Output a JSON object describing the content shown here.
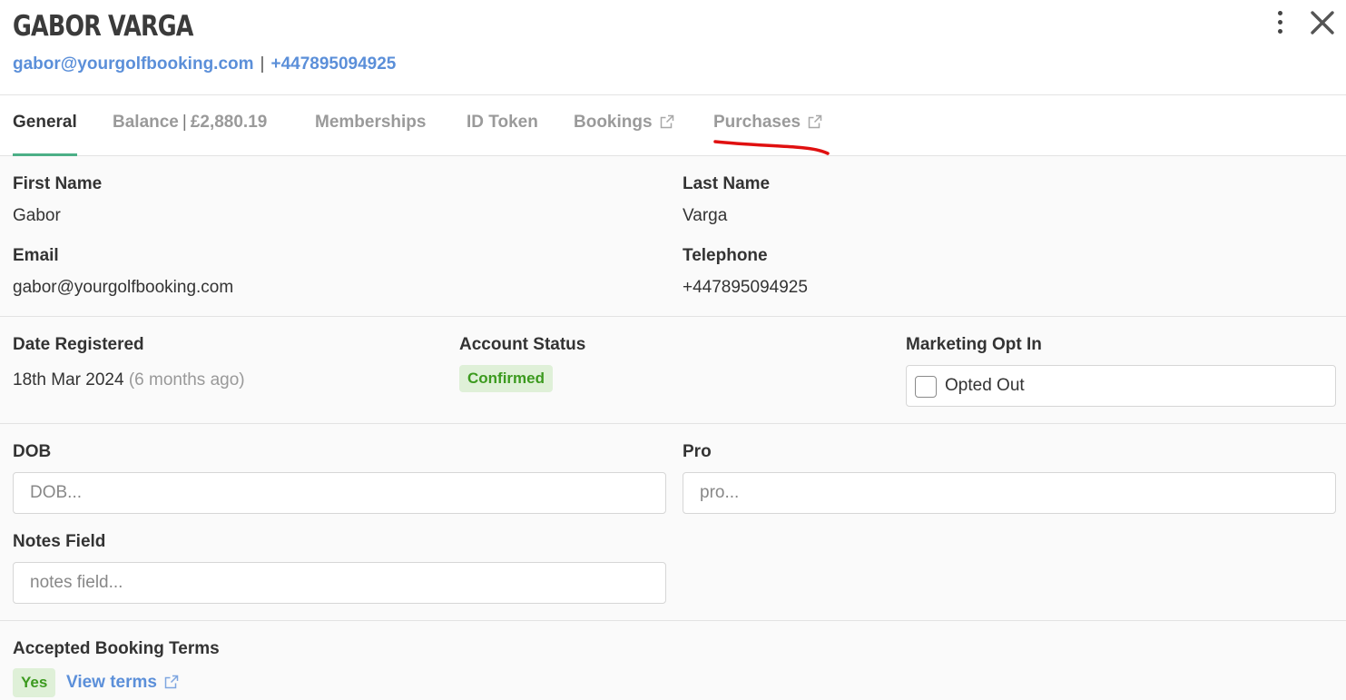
{
  "header": {
    "name": "GABOR VARGA",
    "email": "gabor@yourgolfbooking.com",
    "separator": "|",
    "phone": "+447895094925"
  },
  "tabs": [
    {
      "label": "General",
      "active": true
    },
    {
      "label": "Balance",
      "separator": "|",
      "amount": "£2,880.19"
    },
    {
      "label": "Memberships"
    },
    {
      "label": "ID Token"
    },
    {
      "label": "Bookings",
      "icon": "external-link-icon"
    },
    {
      "label": "Purchases",
      "icon": "external-link-icon"
    }
  ],
  "general": {
    "first_name_label": "First Name",
    "first_name": "Gabor",
    "last_name_label": "Last Name",
    "last_name": "Varga",
    "email_label": "Email",
    "email": "gabor@yourgolfbooking.com",
    "telephone_label": "Telephone",
    "telephone": "+447895094925"
  },
  "registration": {
    "date_label": "Date Registered",
    "date": "18th Mar 2024",
    "relative": "(6 months ago)",
    "status_label": "Account Status",
    "status": "Confirmed",
    "marketing_label": "Marketing Opt In",
    "marketing_value": "Opted Out",
    "marketing_checked": false
  },
  "custom_fields": {
    "dob_label": "DOB",
    "dob_placeholder": "DOB...",
    "pro_label": "Pro",
    "pro_placeholder": "pro...",
    "notes_label": "Notes Field",
    "notes_placeholder": "notes field..."
  },
  "terms": {
    "label": "Accepted Booking Terms",
    "accepted": "Yes",
    "view_link": "View terms"
  },
  "colors": {
    "accent": "#4caf87",
    "link": "#5b8fd9",
    "badge_bg": "#dff0d8",
    "badge_text": "#3c9a1f",
    "annotation": "#e01010"
  }
}
